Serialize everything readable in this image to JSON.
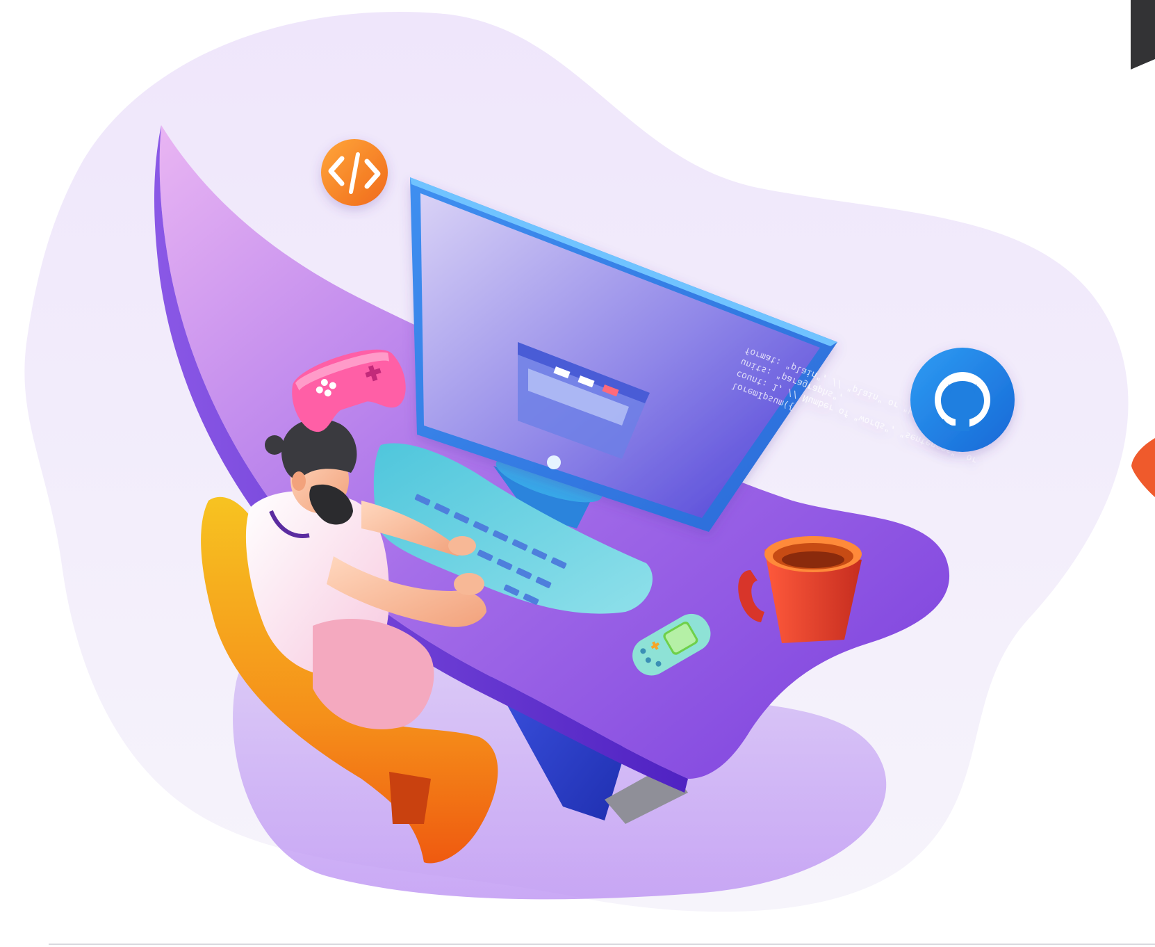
{
  "illustration": {
    "name": "developer-at-desk",
    "screen_code_lines": [
      "loremIpsum({",
      "  count: 1,          // Number of \"words\", \"sentences\", or",
      "  units: \"paragraphs\",",
      "  format: \"plain\",    // \"plain\" or \"html\""
    ]
  },
  "icons": [
    "code-icon",
    "github-icon",
    "gamepad-icon",
    "handheld-console-icon",
    "coffee-mug-icon"
  ],
  "colors": {
    "blob_background": "#f1ecfb",
    "desk_purple": "#8a4fe0",
    "desk_edge": "#5b2ccc",
    "monitor_frame": "#2f8fe6",
    "keyboard_teal": "#7fd5e3",
    "chair_orange": "#f39a1d",
    "code_badge_orange": "#f7892a",
    "github_badge_blue": "#1f86e6",
    "mug_red": "#e2482e",
    "gamepad_pink": "#ff6fb0"
  }
}
